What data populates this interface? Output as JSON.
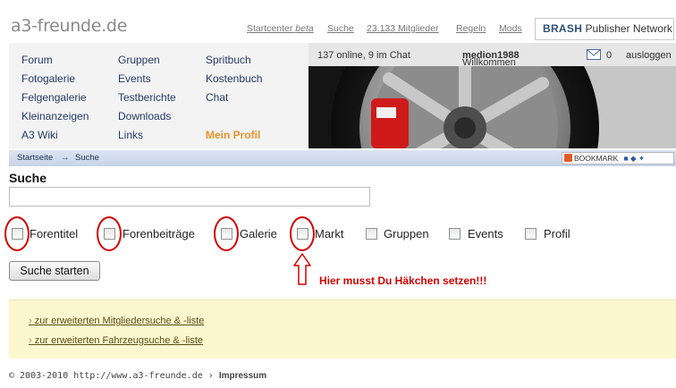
{
  "header": {
    "logo": "a3-freunde.de",
    "links": {
      "startcenter": "Startcenter",
      "beta": "beta",
      "suche": "Suche",
      "mitglieder": "23.133 Mitglieder",
      "regeln": "Regeln",
      "mods": "Mods"
    },
    "publisher_brand": "BRASH",
    "publisher_text": "Publisher Network"
  },
  "nav": {
    "col1": [
      "Forum",
      "Fotogalerie",
      "Felgengalerie",
      "Kleinanzeigen",
      "A3 Wiki"
    ],
    "col2": [
      "Gruppen",
      "Events",
      "Testberichte",
      "Downloads",
      "Links"
    ],
    "col3": [
      "Spritbuch",
      "Kostenbuch",
      "Chat",
      "",
      "Mein Profil"
    ]
  },
  "status": {
    "online": "137 online, 9 im Chat",
    "welcome": "Willkommen",
    "username": "medion1988",
    "messages": "0",
    "logout": "ausloggen"
  },
  "breadcrumb": {
    "home": "Startseite",
    "arrow": "→",
    "current": "Suche"
  },
  "bookmark": {
    "label": "BOOKMARK"
  },
  "search": {
    "heading": "Suche",
    "value": "",
    "options": [
      "Forentitel",
      "Forenbeiträge",
      "Galerie",
      "Markt",
      "Gruppen",
      "Events",
      "Profil"
    ],
    "submit_label": "Suche starten"
  },
  "annotation": {
    "text": "Hier musst Du Häkchen setzen!!!",
    "color": "#d10000"
  },
  "extra_links": {
    "chevron": "›",
    "member_search": "zur erweiterten Mitgliedersuche & -liste",
    "vehicle_search": "zur erweiterten Fahrzeugsuche & -liste"
  },
  "footer": {
    "copyright": "© 2003-2010 http://www.a3-freunde.de ›",
    "impressum": "Impressum"
  },
  "colors": {
    "nav_link": "#243b66",
    "profile_link": "#e8922a",
    "annotation_red": "#d10000",
    "info_box": "#fdf7cf",
    "breadcrumb_bar": "#cdd8ea"
  }
}
